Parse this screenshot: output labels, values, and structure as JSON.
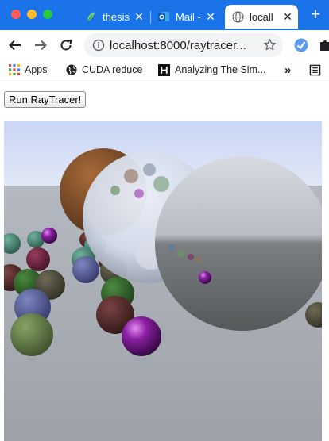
{
  "browser": {
    "tabs": [
      {
        "title": "thesis",
        "icon": "leaf-icon",
        "active": false
      },
      {
        "title": "Mail -",
        "icon": "outlook-icon",
        "active": false
      },
      {
        "title": "locall",
        "icon": "globe-icon",
        "active": true
      }
    ],
    "close_glyph": "✕",
    "new_tab_glyph": "+",
    "url": "localhost:8000/raytracer..."
  },
  "bookmarks": [
    {
      "label": "Apps",
      "icon": "apps-grid-icon"
    },
    {
      "label": "CUDA reduce",
      "icon": "globe-icon"
    },
    {
      "label": "Analyzing The Sim...",
      "icon": "hn-icon"
    }
  ],
  "bookmarks_more_glyph": "»",
  "page": {
    "run_button_label": "Run RayTracer!"
  },
  "colors": {
    "tab_strip": "#1a73e8",
    "sky_top": "#c8d6f5",
    "ground": "#9ea4ad"
  }
}
